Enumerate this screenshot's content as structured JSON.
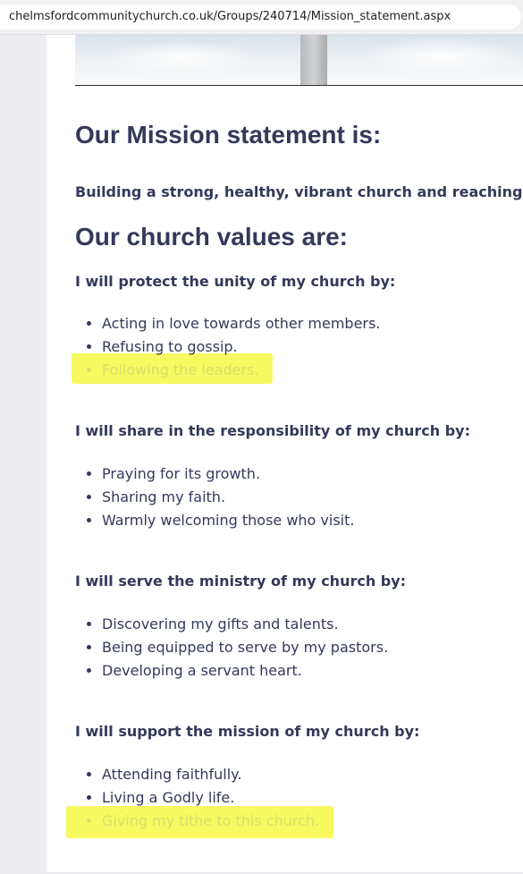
{
  "browser": {
    "url": "chelmsfordcommunitychurch.co.uk/Groups/240714/Mission_statement.aspx"
  },
  "page": {
    "mission_heading": "Our Mission statement is:",
    "mission_text": "Building a strong, healthy, vibrant church and reaching out to",
    "values_heading": "Our church values are:",
    "groups": [
      {
        "heading": "I will protect the unity of my church by:",
        "items": [
          {
            "text": "Acting in love towards other members.",
            "highlighted": false
          },
          {
            "text": "Refusing to gossip.",
            "highlighted": false
          },
          {
            "text": "Following the leaders.",
            "highlighted": true
          }
        ]
      },
      {
        "heading": "I will share in the responsibility of my church by:",
        "items": [
          {
            "text": "Praying for its growth.",
            "highlighted": false
          },
          {
            "text": "Sharing my faith.",
            "highlighted": false
          },
          {
            "text": "Warmly welcoming those who visit.",
            "highlighted": false
          }
        ]
      },
      {
        "heading": "I will serve the ministry of my church by:",
        "items": [
          {
            "text": "Discovering my gifts and talents.",
            "highlighted": false
          },
          {
            "text": "Being equipped to serve by my pastors.",
            "highlighted": false
          },
          {
            "text": "Developing a servant heart.",
            "highlighted": false
          }
        ]
      },
      {
        "heading": "I will support the mission of my church by:",
        "items": [
          {
            "text": "Attending faithfully.",
            "highlighted": false
          },
          {
            "text": "Living a Godly life.",
            "highlighted": false
          },
          {
            "text": "Giving my tithe to this church.",
            "highlighted": true
          }
        ]
      }
    ]
  },
  "colors": {
    "text": "#34395a",
    "highlight_marker": "#f6f638",
    "highlighted_text": "#d6df6a"
  }
}
